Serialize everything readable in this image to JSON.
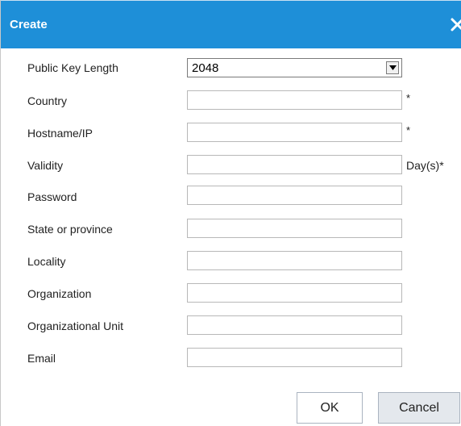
{
  "dialog": {
    "title": "Create",
    "close_icon": "close-icon"
  },
  "form": {
    "public_key_length": {
      "label": "Public Key Length",
      "value": "2048"
    },
    "country": {
      "label": "Country",
      "value": "",
      "required_mark": "*"
    },
    "hostname": {
      "label": "Hostname/IP",
      "value": "",
      "required_mark": "*"
    },
    "validity": {
      "label": "Validity",
      "value": "",
      "suffix": "Day(s)*"
    },
    "password": {
      "label": "Password",
      "value": ""
    },
    "state": {
      "label": "State or province",
      "value": ""
    },
    "locality": {
      "label": "Locality",
      "value": ""
    },
    "organization": {
      "label": "Organization",
      "value": ""
    },
    "org_unit": {
      "label": "Organizational Unit",
      "value": ""
    },
    "email": {
      "label": "Email",
      "value": ""
    }
  },
  "buttons": {
    "ok": "OK",
    "cancel": "Cancel"
  },
  "colors": {
    "titlebar": "#1e8fd8",
    "title_text": "#ffffff"
  }
}
